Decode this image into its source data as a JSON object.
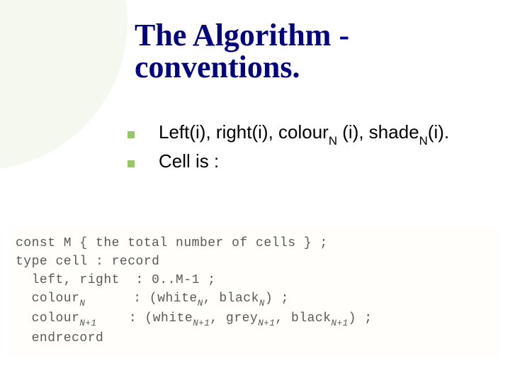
{
  "title": "The Algorithm - conventions.",
  "bullets": {
    "b1": {
      "pre": "Left(i), right(i), colour",
      "sub1": "N",
      "mid": " (i), shade",
      "sub2": "N",
      "post": "(i)."
    },
    "b2": "Cell is :"
  },
  "code": {
    "l0_a": "const M { the total number of cells } ;",
    "l1_a": "type cell : record",
    "l2_a": "  left, right  : 0..M-1 ;",
    "l3_a": "  colour",
    "l3_sub": "N",
    "l3_b": "      : (white",
    "l3_sub2": "N",
    "l3_c": ", black",
    "l3_sub3": "N",
    "l3_d": ") ;",
    "l4_a": "  colour",
    "l4_sub": "N+1",
    "l4_b": "    : (white",
    "l4_sub2": "N+1",
    "l4_c": ", grey",
    "l4_sub3": "N+1",
    "l4_d": ", black",
    "l4_sub4": "N+1",
    "l4_e": ") ;",
    "l5_a": "  endrecord"
  }
}
